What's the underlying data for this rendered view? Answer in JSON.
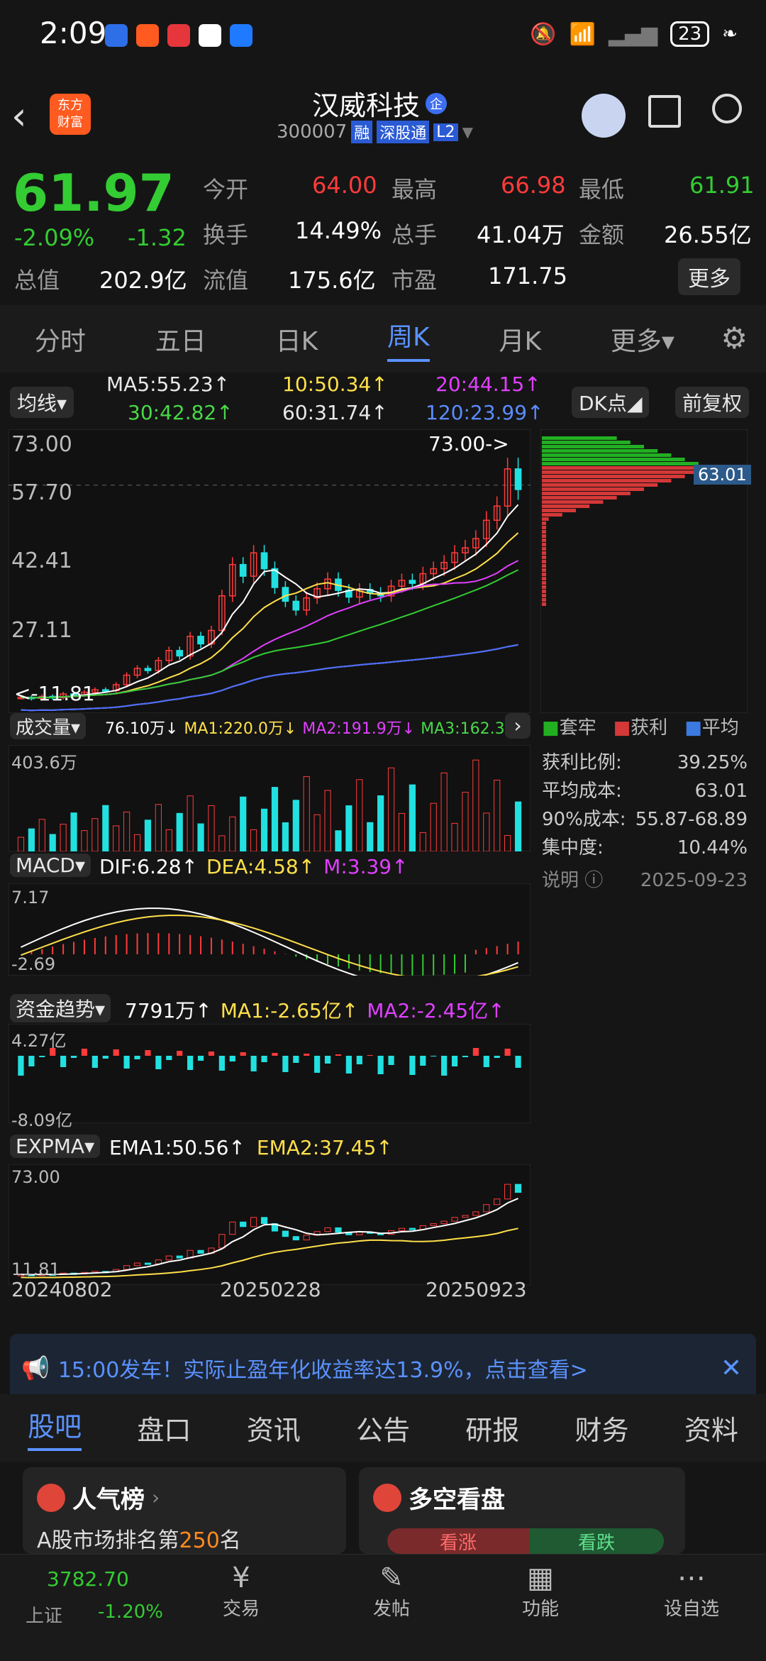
{
  "status": {
    "time": "2:09",
    "battery": "23"
  },
  "header": {
    "stock_name": "汉威科技",
    "badge": "企",
    "code": "300007",
    "tags": [
      "融",
      "深股通",
      "L2"
    ],
    "logo_text": "东方\n财富"
  },
  "quote": {
    "price": "61.97",
    "change_pct": "-2.09%",
    "change": "-1.32",
    "fields": [
      {
        "label": "今开",
        "value": "64.00"
      },
      {
        "label": "最高",
        "value": "66.98"
      },
      {
        "label": "最低",
        "value": "61.91"
      },
      {
        "label": "换手",
        "value": "14.49%"
      },
      {
        "label": "总手",
        "value": "41.04万"
      },
      {
        "label": "金额",
        "value": "26.55亿"
      },
      {
        "label": "总值",
        "value": "202.9亿"
      },
      {
        "label": "流值",
        "value": "175.6亿"
      },
      {
        "label": "市盈",
        "value": "171.75"
      }
    ],
    "more": "更多"
  },
  "tabs": [
    "分时",
    "五日",
    "日K",
    "周K",
    "月K",
    "更多"
  ],
  "active_tab": "周K",
  "ma": {
    "label": "均线",
    "items": [
      "MA5:55.23↑",
      "10:50.34↑",
      "20:44.15↑",
      "30:42.82↑",
      "60:31.74↑",
      "120:23.99↑"
    ],
    "dk": "DK点",
    "fq": "前复权"
  },
  "main_chart": {
    "y_labels": [
      "73.00",
      "57.70",
      "42.41",
      "27.11"
    ],
    "high_marker": "73.00->",
    "low_marker": "<-11.81",
    "profile_value": "63.01"
  },
  "chart_data": {
    "type": "candlestick",
    "title": "汉威科技 周K",
    "x_labels": [
      "20240802",
      "20250228",
      "20250923"
    ],
    "close": [
      12.2,
      11.9,
      12.4,
      12.1,
      13.0,
      12.8,
      13.4,
      14.0,
      13.8,
      15.2,
      17.5,
      19.1,
      18.6,
      21.0,
      23.4,
      22.1,
      26.8,
      25.0,
      28.2,
      36.5,
      44.0,
      41.2,
      46.8,
      43.0,
      38.5,
      35.2,
      33.1,
      36.0,
      38.2,
      40.5,
      37.8,
      36.2,
      38.0,
      37.1,
      36.5,
      38.8,
      40.2,
      39.5,
      41.8,
      43.0,
      44.5,
      46.8,
      48.0,
      50.2,
      54.6,
      58.0,
      66.9,
      61.97
    ],
    "ma_lines": [
      {
        "name": "MA5",
        "value": "55.23"
      },
      {
        "name": "MA10",
        "value": "50.34"
      },
      {
        "name": "MA20",
        "value": "44.15"
      },
      {
        "name": "MA30",
        "value": "42.82"
      },
      {
        "name": "MA60",
        "value": "31.74"
      },
      {
        "name": "MA120",
        "value": "23.99"
      }
    ],
    "ylim": [
      11.81,
      73.0
    ]
  },
  "chip": {
    "legend": [
      "套牢",
      "获利",
      "平均"
    ],
    "rows": [
      {
        "label": "获利比例:",
        "value": "39.25%"
      },
      {
        "label": "平均成本:",
        "value": "63.01"
      },
      {
        "label": "90%成本:",
        "value": "55.87-68.89"
      },
      {
        "label": "集中度:",
        "value": "10.44%"
      }
    ],
    "note": "说明",
    "date": "2025-09-23"
  },
  "volume": {
    "label": "成交量",
    "items": [
      "76.10万↓",
      "MA1:220.0万↓",
      "MA2:191.9万↓",
      "MA3:162.3万↓"
    ],
    "ymax": "403.6万"
  },
  "macd": {
    "label": "MACD",
    "items": [
      "DIF:6.28↑",
      "DEA:4.58↑",
      "M:3.39↑"
    ],
    "ymax": "7.17",
    "ymin": "-2.69"
  },
  "fund": {
    "label": "资金趋势",
    "items": [
      "7791万↑",
      "MA1:-2.65亿↑",
      "MA2:-2.45亿↑"
    ],
    "ymax": "4.27亿",
    "ymin": "-8.09亿"
  },
  "expma": {
    "label": "EXPMA",
    "items": [
      "EMA1:50.56↑",
      "EMA2:37.45↑"
    ],
    "ymax": "73.00",
    "ymin": "11.81"
  },
  "ad": {
    "text": "15:00发车！实际止盈年化收益率达13.9%，点击查看>"
  },
  "bottom_tabs": [
    "股吧",
    "盘口",
    "资讯",
    "公告",
    "研报",
    "财务",
    "资料"
  ],
  "active_bottom_tab": "股吧",
  "cards": [
    {
      "title": "人气榜",
      "sub_prefix": "A股市场排名第",
      "rank": "250",
      "sub_suffix": "名"
    },
    {
      "title": "多空看盘",
      "up": "看涨",
      "down": "看跌"
    }
  ],
  "bottom_bar": {
    "index_value": "3782.70",
    "index_name": "上证",
    "index_change": "-1.20%",
    "items": [
      "交易",
      "发帖",
      "功能",
      "设自选"
    ]
  }
}
